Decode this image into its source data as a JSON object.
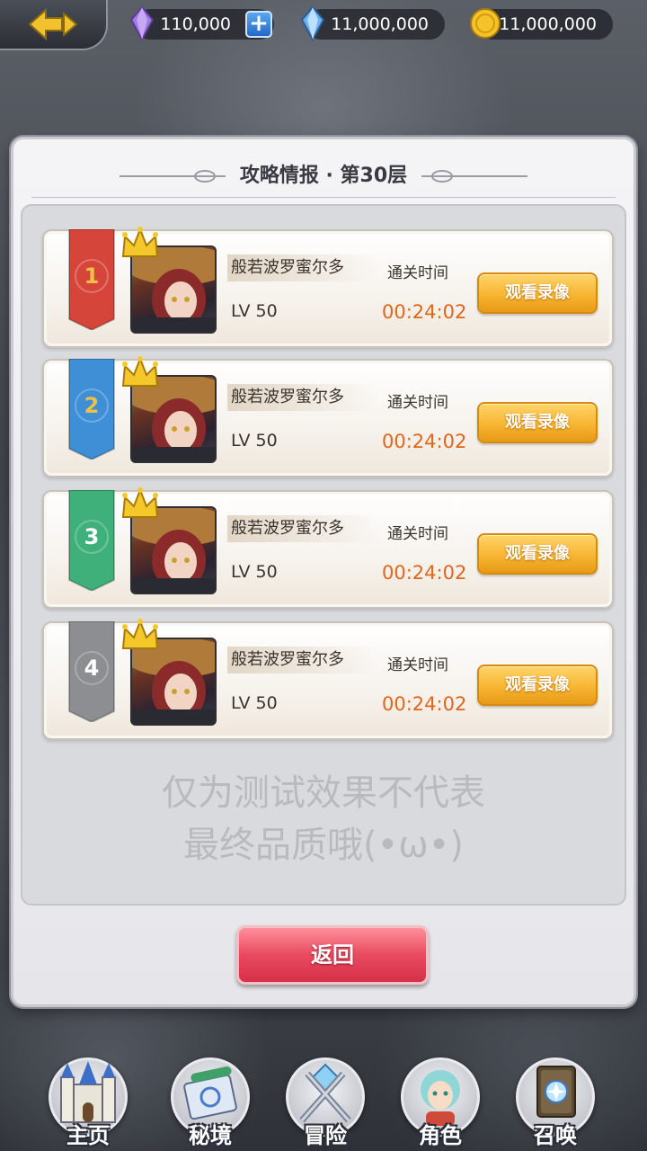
{
  "topbar": {
    "back_icon": "back-arrow-icon",
    "resources": [
      {
        "icon": "purple-crystal-icon",
        "value": "110,000",
        "has_plus": true,
        "plus_label": "+"
      },
      {
        "icon": "blue-crystal-icon",
        "value": "11,000,000"
      },
      {
        "icon": "gold-coin-icon",
        "value": "11,000,000"
      }
    ]
  },
  "panel": {
    "title": "攻略情报 · 第30层",
    "entries": [
      {
        "rank": "1",
        "ribbon_color": "#d6453a",
        "rank_color": "#f0c048",
        "name": "般若波罗蜜尔多",
        "level": "LV 50",
        "clear_label": "通关时间",
        "clear_time": "00:24:02",
        "button": "观看录像"
      },
      {
        "rank": "2",
        "ribbon_color": "#3f8fd6",
        "rank_color": "#f0c048",
        "name": "般若波罗蜜尔多",
        "level": "LV 50",
        "clear_label": "通关时间",
        "clear_time": "00:24:02",
        "button": "观看录像"
      },
      {
        "rank": "3",
        "ribbon_color": "#3fb07a",
        "rank_color": "#ffffff",
        "name": "般若波罗蜜尔多",
        "level": "LV 50",
        "clear_label": "通关时间",
        "clear_time": "00:24:02",
        "button": "观看录像"
      },
      {
        "rank": "4",
        "ribbon_color": "#8c8e92",
        "rank_color": "#ffffff",
        "name": "般若波罗蜜尔多",
        "level": "LV 50",
        "clear_label": "通关时间",
        "clear_time": "00:24:02",
        "button": "观看录像"
      }
    ],
    "note_line1": "仅为测试效果不代表",
    "note_line2": "最终品质哦(•ω•)",
    "return_button": "返回"
  },
  "nav": [
    {
      "icon": "castle-icon",
      "label": "主页"
    },
    {
      "icon": "scroll-map-icon",
      "label": "秘境"
    },
    {
      "icon": "crossed-swords-icon",
      "label": "冒险"
    },
    {
      "icon": "character-portrait-icon",
      "label": "角色"
    },
    {
      "icon": "summon-book-icon",
      "label": "召唤"
    }
  ]
}
